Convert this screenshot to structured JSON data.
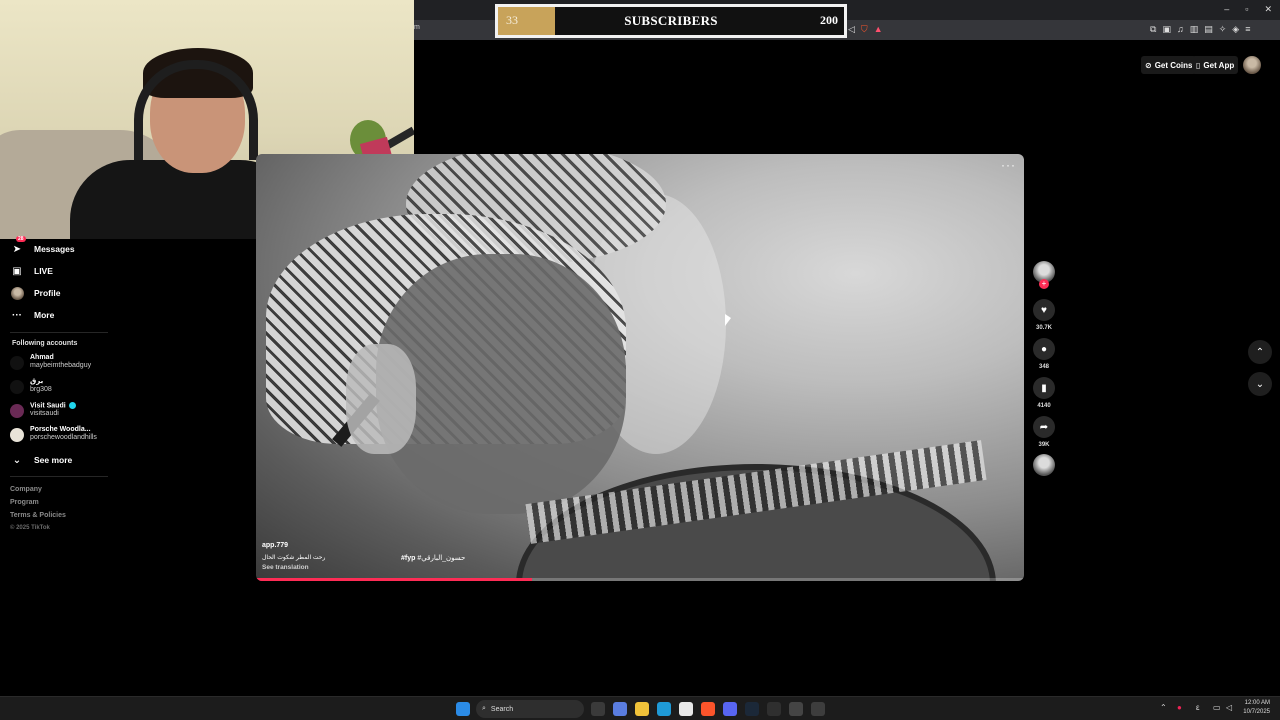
{
  "browser": {
    "url_fragment": "m",
    "window_controls": [
      "–",
      "▫",
      "✕"
    ]
  },
  "subscriber_goal": {
    "current": "33",
    "title": "SUBSCRIBERS",
    "goal": "200",
    "progress_fraction": 0.165,
    "fill_color": "#c8a35a"
  },
  "header": {
    "get_coins": "Get Coins",
    "get_app": "Get App"
  },
  "sidebar": {
    "items": [
      {
        "label": "Messages",
        "icon": "paper-plane-icon",
        "badge": "28"
      },
      {
        "label": "LIVE",
        "icon": "tv-icon"
      },
      {
        "label": "Profile",
        "icon": "avatar"
      },
      {
        "label": "More",
        "icon": "more-dots-icon"
      }
    ],
    "following_title": "Following accounts",
    "accounts": [
      {
        "name": "Ahmad",
        "user": "maybeimthebadguy"
      },
      {
        "name": "برق",
        "user": "brg308"
      },
      {
        "name": "Visit Saudi",
        "user": "visitsaudi",
        "verified": true
      },
      {
        "name": "Porsche Woodla...",
        "user": "porschewoodlandhills"
      }
    ],
    "see_more": "See more",
    "footer": [
      "Company",
      "Program",
      "Terms & Policies"
    ],
    "copyright": "© 2025 TikTok"
  },
  "video": {
    "menu": "···",
    "author": "app.779",
    "description": "رحت المطر شكوت الحال",
    "hashtags": [
      "#fyp",
      "#حسون_البارقي"
    ],
    "see_translation": "See translation",
    "progress_fraction": 0.36,
    "accent_color": "#fe2c55"
  },
  "actions": {
    "likes": "30.7K",
    "comments": "348",
    "saves": "4140",
    "shares": "39K"
  },
  "taskbar": {
    "search_label": "Search",
    "time": "12:00 AM",
    "date": "10/7/2025"
  }
}
